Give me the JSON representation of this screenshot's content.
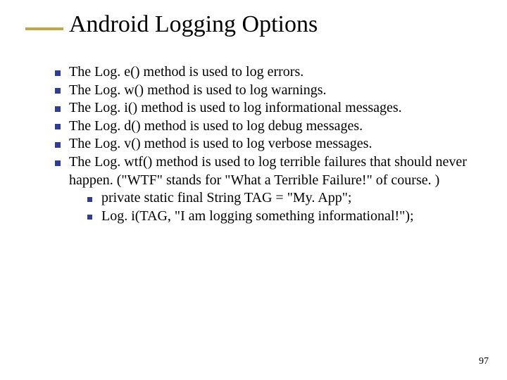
{
  "title": "Android Logging Options",
  "bullets": [
    "The  Log. e()  method is used to log errors.",
    "The  Log. w()  method is used to log warnings.",
    "The  Log. i()  method is used to log informational messages.",
    "The  Log. d()  method is used to log debug messages.",
    "The  Log. v()  method is used to log verbose messages.",
    "The  Log. wtf()  method is used to log terrible failures that should never happen. (\"WTF\" stands for \"What a Terrible Failure!\" of course. )"
  ],
  "sub_bullets": [
    "private   static   final  String TAG = \"My. App\";",
    "Log. i(TAG, \"I am logging something informational!\");"
  ],
  "page_number": "97"
}
